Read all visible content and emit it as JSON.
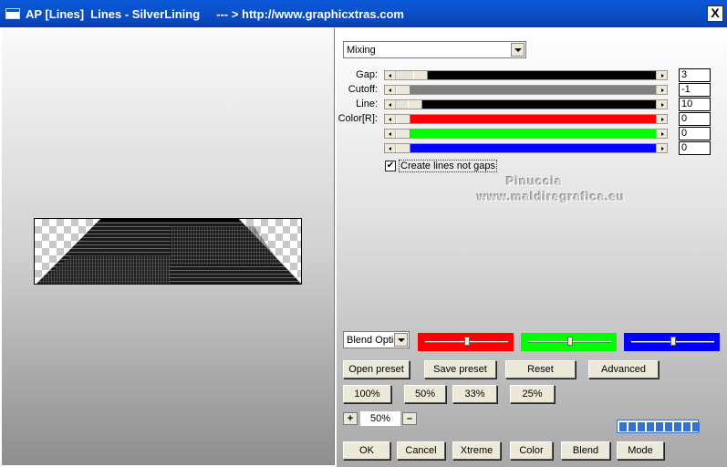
{
  "window": {
    "title": "AP [Lines]  Lines - SilverLining     --- > http://www.graphicxtras.com",
    "close_glyph": "X"
  },
  "mode_dropdown": {
    "value": "Mixing"
  },
  "sliders": [
    {
      "label": "Gap:",
      "value": "3",
      "fill_color": "#000000",
      "position": 0.07
    },
    {
      "label": "Cutoff:",
      "value": "-1",
      "fill_color": "#808080",
      "position": 0.0
    },
    {
      "label": "Line:",
      "value": "10",
      "fill_color": "#000000",
      "position": 0.05
    },
    {
      "label": "Color[R]:",
      "value": "0",
      "fill_color": "#ff0000",
      "position": 0.0
    },
    {
      "label": "",
      "value": "0",
      "fill_color": "#00ff00",
      "position": 0.0
    },
    {
      "label": "",
      "value": "0",
      "fill_color": "#0000ff",
      "position": 0.0
    }
  ],
  "option": {
    "label": "Create lines not gaps",
    "checked": true,
    "check_glyph": "✔"
  },
  "watermark": {
    "line1": "Pinuccia",
    "line2": "www.maldiregrafica.eu"
  },
  "blend_dropdown": {
    "value": "Blend Optio"
  },
  "color_panels": [
    {
      "color": "#ff0000",
      "position": 0.5
    },
    {
      "color": "#00ff00",
      "position": 0.5
    },
    {
      "color": "#0000ff",
      "position": 0.5
    }
  ],
  "preset_buttons": [
    "Open preset",
    "Save preset",
    "Reset",
    "Advanced"
  ],
  "zoom_presets": [
    "100%",
    "50%",
    "33%",
    "25%"
  ],
  "zoom": {
    "minus": "–",
    "plus": "+",
    "value": "50%"
  },
  "progress": {
    "segments": 9
  },
  "action_buttons": [
    "OK",
    "Cancel",
    "Xtreme",
    "Color",
    "Blend",
    "Mode"
  ]
}
